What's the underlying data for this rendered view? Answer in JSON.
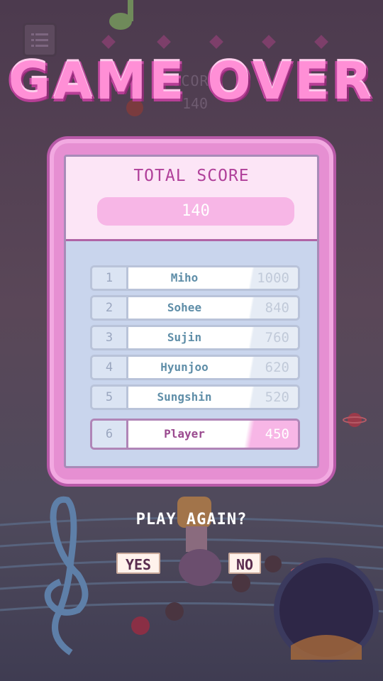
{
  "title": "GAME OVER",
  "background": {
    "score_label": "SCORE",
    "score_value": "140"
  },
  "results": {
    "total_label": "TOTAL SCORE",
    "total_value": "140",
    "leaderboard": [
      {
        "rank": "1",
        "name": "Miho",
        "score": "1000"
      },
      {
        "rank": "2",
        "name": "Sohee",
        "score": "840"
      },
      {
        "rank": "3",
        "name": "Sujin",
        "score": "760"
      },
      {
        "rank": "4",
        "name": "Hyunjoo",
        "score": "620"
      },
      {
        "rank": "5",
        "name": "Sungshin",
        "score": "520"
      },
      {
        "rank": "6",
        "name": "Player",
        "score": "450"
      }
    ]
  },
  "prompt": {
    "text": "PLAY AGAIN?",
    "yes_label": "YES",
    "no_label": "NO"
  },
  "colors": {
    "title_pink": "#ff8fd6",
    "panel_pink": "#e68fd2",
    "panel_inner": "#c9d5ed",
    "name_blue": "#5f8ea8",
    "player_purple": "#9a4a8f"
  },
  "icons": [
    "menu-icon",
    "music-note-icon",
    "treble-clef-icon",
    "planet-icon",
    "crystal-icon",
    "character-sprite"
  ]
}
